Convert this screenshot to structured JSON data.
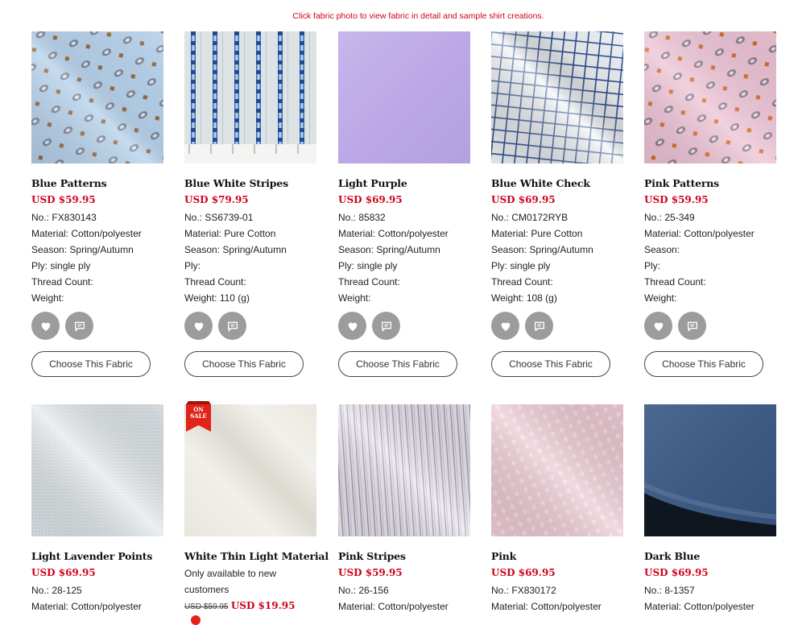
{
  "hint": "Click fabric photo to view fabric in detail and sample shirt creations.",
  "labels": {
    "no": "No.:",
    "material": "Material:",
    "season": "Season:",
    "ply": "Ply:",
    "thread": "Thread Count:",
    "weight": "Weight:",
    "choose": "Choose This Fabric",
    "on_sale_line1": "ON",
    "on_sale_line2": "SALE"
  },
  "row1": [
    {
      "name": "Blue Patterns",
      "price": "USD $59.95",
      "no": "FX830143",
      "material": "Cotton/polyester",
      "season": "Spring/Autumn",
      "ply": "single ply",
      "thread": "",
      "weight": ""
    },
    {
      "name": "Blue White Stripes",
      "price": "USD $79.95",
      "no": "SS6739-01",
      "material": "Pure Cotton",
      "season": "Spring/Autumn",
      "ply": "",
      "thread": "",
      "weight": "110 (g)"
    },
    {
      "name": "Light Purple",
      "price": "USD $69.95",
      "no": "85832",
      "material": "Cotton/polyester",
      "season": "Spring/Autumn",
      "ply": "single ply",
      "thread": "",
      "weight": ""
    },
    {
      "name": "Blue White Check",
      "price": "USD $69.95",
      "no": "CM0172RYB",
      "material": "Pure Cotton",
      "season": "Spring/Autumn",
      "ply": "single ply",
      "thread": "",
      "weight": "108 (g)"
    },
    {
      "name": "Pink Patterns",
      "price": "USD $59.95",
      "no": "25-349",
      "material": "Cotton/polyester",
      "season": "",
      "ply": "",
      "thread": "",
      "weight": ""
    }
  ],
  "row2": [
    {
      "name": "Light Lavender Points",
      "price": "USD $69.95",
      "no": "28-125",
      "material": "Cotton/polyester"
    },
    {
      "name": "White Thin Light Material",
      "note": "Only available to new customers",
      "old_price": "USD $59.95",
      "sale_price": "USD $19.95"
    },
    {
      "name": "Pink Stripes",
      "price": "USD $59.95",
      "no": "26-156",
      "material": "Cotton/polyester"
    },
    {
      "name": "Pink",
      "price": "USD $69.95",
      "no": "FX830172",
      "material": "Cotton/polyester"
    },
    {
      "name": "Dark Blue",
      "price": "USD $69.95",
      "no": "8-1357",
      "material": "Cotton/polyester"
    }
  ],
  "colors": {
    "accent": "#d0021b",
    "icon_bg": "#9c9c9c"
  },
  "icons": [
    "heart-icon",
    "chat-bubble-icon"
  ]
}
